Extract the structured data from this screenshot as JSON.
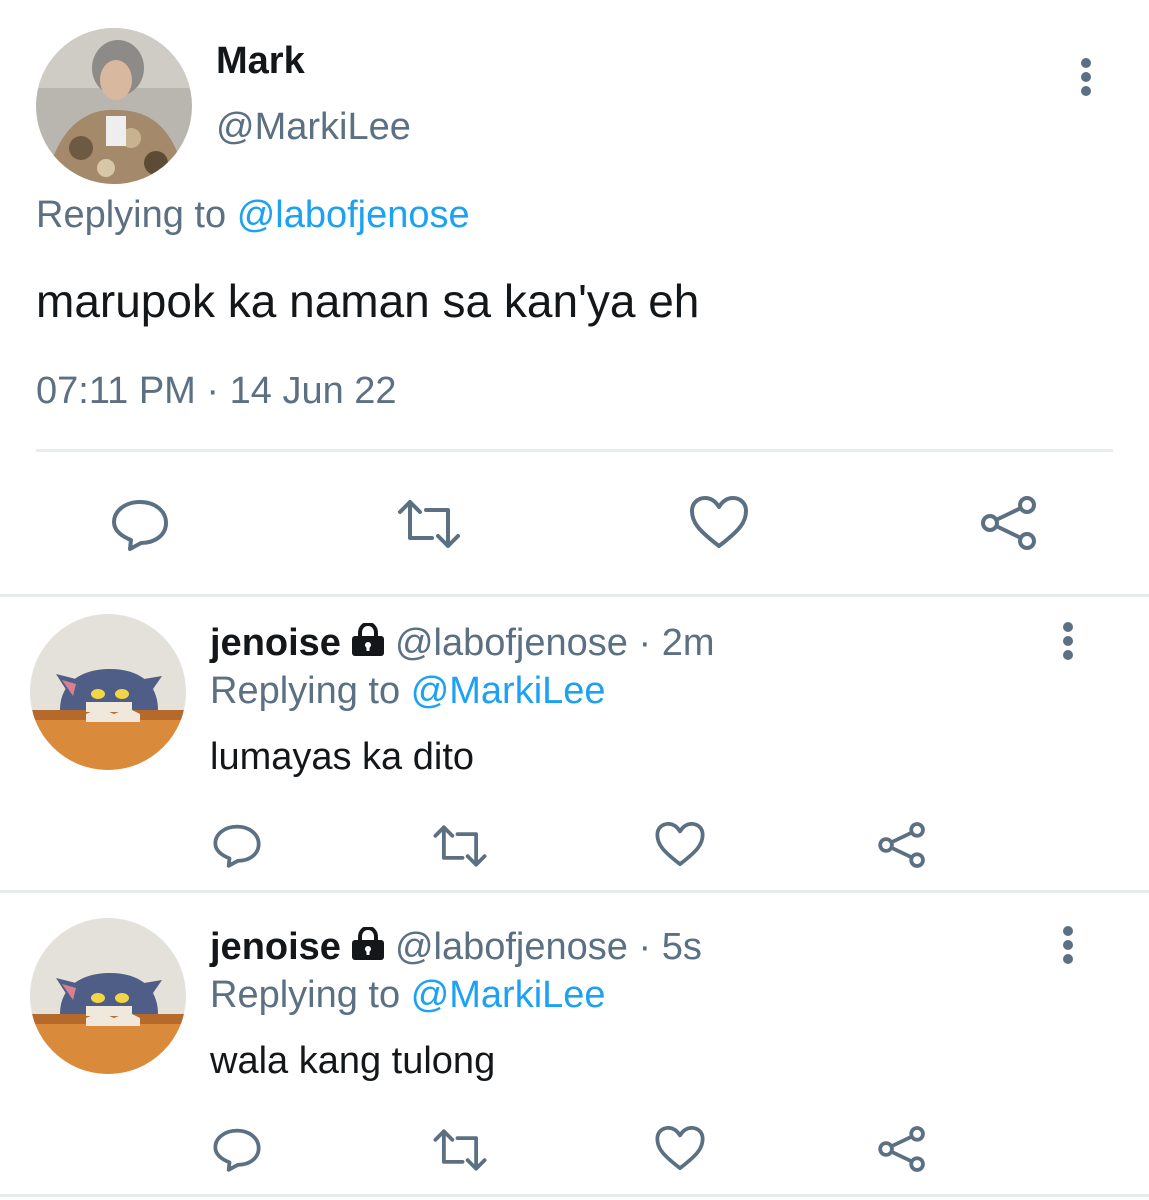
{
  "main_tweet": {
    "display_name": "Mark",
    "handle": "@MarkiLee",
    "replying_prefix": "Replying to",
    "replying_to": "@labofjenose",
    "text": "marupok ka naman sa kan'ya eh",
    "time": "07:11 PM",
    "separator": "·",
    "date": "14 Jun 22",
    "actions": [
      "reply-icon",
      "retweet-icon",
      "like-icon",
      "share-icon"
    ]
  },
  "replies": [
    {
      "display_name": "jenoise",
      "locked": true,
      "handle": "@labofjenose",
      "separator": "·",
      "time_ago": "2m",
      "replying_prefix": "Replying to",
      "replying_to": "@MarkiLee",
      "text": "lumayas ka dito"
    },
    {
      "display_name": "jenoise",
      "locked": true,
      "handle": "@labofjenose",
      "separator": "·",
      "time_ago": "5s",
      "replying_prefix": "Replying to",
      "replying_to": "@MarkiLee",
      "text": "wala kang tulong"
    }
  ],
  "colors": {
    "link": "#1da1f2",
    "secondary_text": "#5b7083",
    "icon": "#5b7083",
    "divider": "#e6ecf0"
  }
}
